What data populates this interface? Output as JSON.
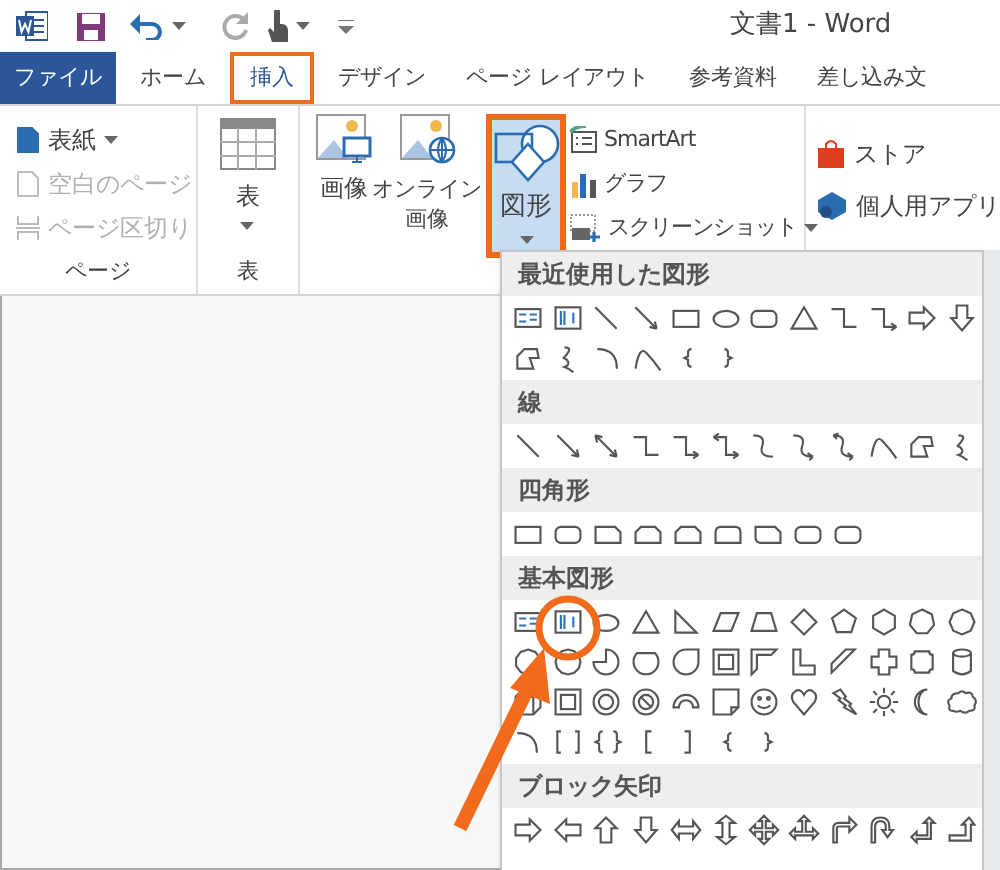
{
  "title_bar": {
    "title": "文書1 - Word"
  },
  "tabs": [
    {
      "label": "ファイル",
      "kind": "file",
      "selected": false,
      "highlighted": false
    },
    {
      "label": "ホーム",
      "kind": "tab",
      "selected": false,
      "highlighted": false
    },
    {
      "label": "挿入",
      "kind": "tab",
      "selected": true,
      "highlighted": true
    },
    {
      "label": "デザイン",
      "kind": "tab",
      "selected": false,
      "highlighted": false
    },
    {
      "label": "ページ レイアウト",
      "kind": "tab",
      "selected": false,
      "highlighted": false
    },
    {
      "label": "参考資料",
      "kind": "tab",
      "selected": false,
      "highlighted": false
    },
    {
      "label": "差し込み文",
      "kind": "tab",
      "selected": false,
      "highlighted": false
    }
  ],
  "ribbon": {
    "page_group": {
      "label": "ページ",
      "items": [
        {
          "label": "表紙",
          "disabled": false,
          "dropdown": true
        },
        {
          "label": "空白のページ",
          "disabled": true,
          "dropdown": false
        },
        {
          "label": "ページ区切り",
          "disabled": true,
          "dropdown": false
        }
      ]
    },
    "table_group": {
      "label": "表",
      "button": {
        "label": "表",
        "dropdown": true
      }
    },
    "illustrations": {
      "pictures": {
        "lines": [
          "画像"
        ]
      },
      "online_pictures": {
        "lines": [
          "オンライン",
          "画像"
        ]
      },
      "shapes": {
        "label": "図形",
        "pressed": true,
        "highlighted": true,
        "dropdown": true
      },
      "small": [
        {
          "label": "SmartArt",
          "dropdown": false
        },
        {
          "label": "グラフ",
          "dropdown": false
        },
        {
          "label": "スクリーンショット",
          "dropdown": true
        }
      ]
    },
    "apps": [
      {
        "label": "ストア"
      },
      {
        "label": "個人用アプリ"
      }
    ]
  },
  "shapes_menu": {
    "sections": [
      {
        "title": "最近使用した図形"
      },
      {
        "title": "線"
      },
      {
        "title": "四角形"
      },
      {
        "title": "基本図形"
      },
      {
        "title": "ブロック矢印"
      }
    ]
  }
}
